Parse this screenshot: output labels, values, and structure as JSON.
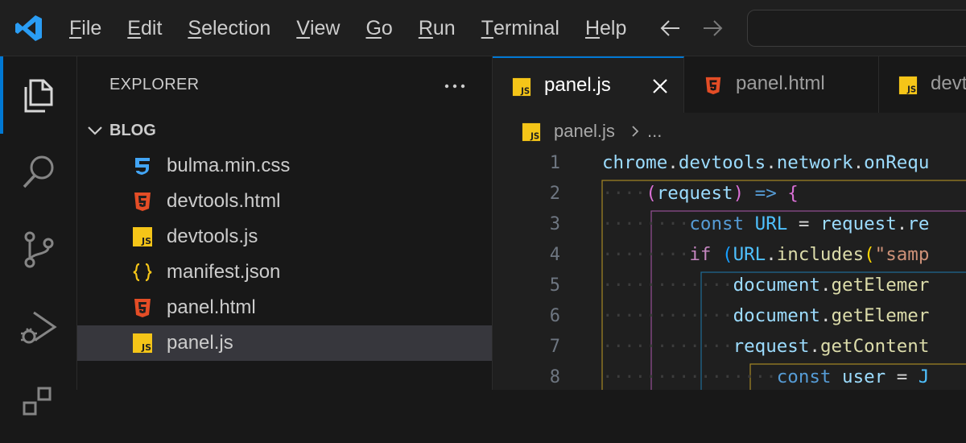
{
  "menu": [
    {
      "accel": "F",
      "rest": "ile"
    },
    {
      "accel": "E",
      "rest": "dit"
    },
    {
      "accel": "S",
      "rest": "election"
    },
    {
      "accel": "V",
      "rest": "iew"
    },
    {
      "accel": "G",
      "rest": "o"
    },
    {
      "accel": "R",
      "rest": "un"
    },
    {
      "accel": "T",
      "rest": "erminal"
    },
    {
      "accel": "H",
      "rest": "elp"
    }
  ],
  "sidebar": {
    "title": "EXPLORER",
    "folder": "BLOG",
    "files": [
      {
        "name": "bulma.min.css",
        "icon": "css-file-icon"
      },
      {
        "name": "devtools.html",
        "icon": "html-file-icon"
      },
      {
        "name": "devtools.js",
        "icon": "js-file-icon"
      },
      {
        "name": "manifest.json",
        "icon": "json-file-icon"
      },
      {
        "name": "panel.html",
        "icon": "html-file-icon"
      },
      {
        "name": "panel.js",
        "icon": "js-file-icon",
        "selected": true
      }
    ]
  },
  "tabs": [
    {
      "label": "panel.js",
      "active": true
    },
    {
      "label": "panel.html",
      "active": false
    },
    {
      "label": "devt",
      "active": false
    }
  ],
  "breadcrumbs": {
    "file": "panel.js",
    "more": "..."
  },
  "code": {
    "line_numbers": [
      "1",
      "2",
      "3",
      "4",
      "5",
      "6",
      "7",
      "8"
    ],
    "l1": {
      "a": "chrome",
      "b": ".",
      "c": "devtools",
      "d": ".",
      "e": "network",
      "f": ".",
      "g": "onRequ"
    },
    "l2": {
      "ws": "····",
      "p": "(",
      "a": "request",
      "q": ")",
      "arrow": " => ",
      "b": "{"
    },
    "l3": {
      "ws": "········",
      "kw": "const",
      "sp": " ",
      "c": "URL",
      "eq": " = ",
      "v": "request",
      "dot": ".",
      "r": "re"
    },
    "l4": {
      "ws": "········",
      "kw": "if",
      "sp": " ",
      "p": "(",
      "c": "URL",
      "dot": ".",
      "f": "includes",
      "q": "(",
      "s": "\"samp"
    },
    "l5": {
      "ws": "············",
      "v": "document",
      "dot": ".",
      "f": "getElemer"
    },
    "l6": {
      "ws": "············",
      "v": "document",
      "dot": ".",
      "f": "getElemer"
    },
    "l7": {
      "ws": "············",
      "v": "request",
      "dot": ".",
      "f": "getContent"
    },
    "l8": {
      "ws": "················",
      "kw": "const",
      "sp": " ",
      "v": "user",
      "eq": " = ",
      "r": "J"
    }
  },
  "colors": {
    "accent": "#0078d4",
    "js": "#f5c518",
    "html": "#e44d26",
    "css": "#42a5f5",
    "json": "#f5c518"
  }
}
